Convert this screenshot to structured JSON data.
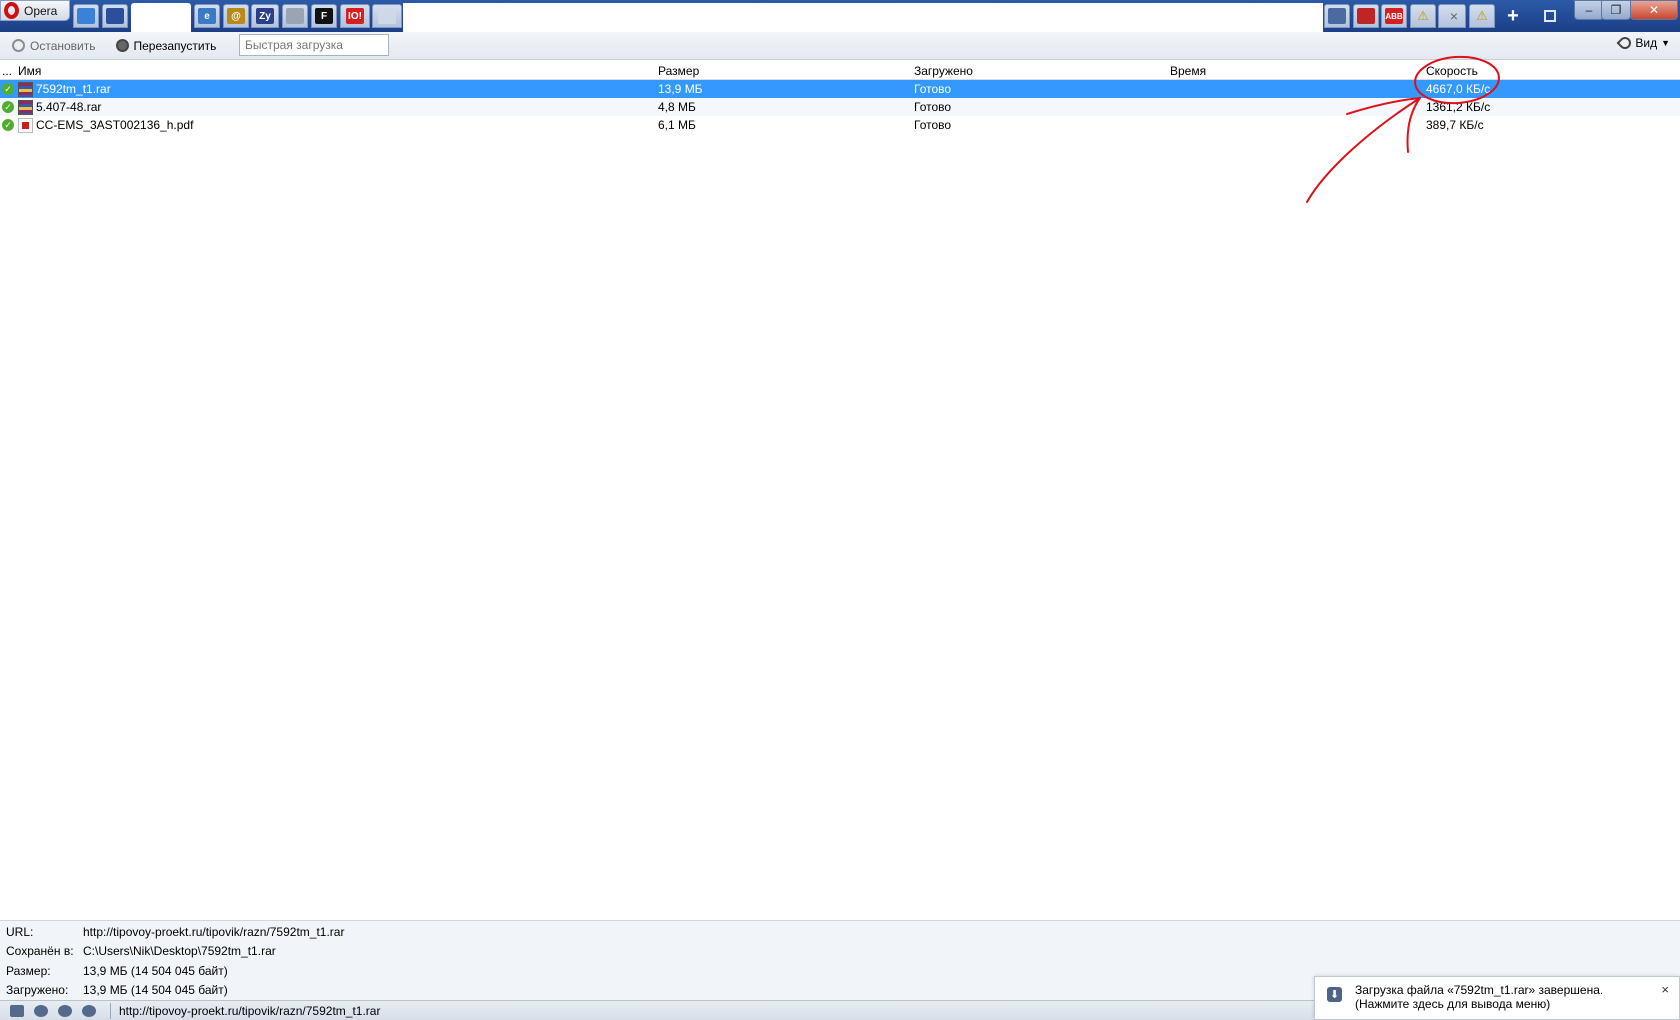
{
  "app": {
    "menu_label": "Opera"
  },
  "tabs": [
    {
      "icon": "water-drop-icon",
      "color": "#3b82d6",
      "glyph": ""
    },
    {
      "icon": "globe-grid-icon",
      "color": "#2b4f9a",
      "glyph": ""
    },
    {
      "icon": "blank-page-icon",
      "color": "#ffffff",
      "glyph": "",
      "active": true
    },
    {
      "icon": "ie-window-icon",
      "color": "#3a79c6",
      "glyph": "e"
    },
    {
      "icon": "at-mail-icon",
      "color": "#b88a1a",
      "glyph": "@"
    },
    {
      "icon": "zy-site-icon",
      "color": "#2b3f8a",
      "glyph": "Zy"
    },
    {
      "icon": "document-icon",
      "color": "#9aa4b3",
      "glyph": ""
    },
    {
      "icon": "f-site-icon",
      "color": "#111111",
      "glyph": "F"
    },
    {
      "icon": "io-site-icon",
      "color": "#d42020",
      "glyph": "IO!"
    },
    {
      "icon": "blank-tab-icon",
      "color": "#cfd8e6",
      "glyph": ""
    }
  ],
  "right_tabs": [
    {
      "icon": "downloads-icon",
      "color": "#4a6aa0",
      "glyph": ""
    },
    {
      "icon": "plane-icon",
      "color": "#c02525",
      "glyph": ""
    },
    {
      "icon": "abb-icon",
      "color": "#d42020",
      "glyph": "ABB"
    },
    {
      "icon": "warning-icon",
      "color": "#e3b400",
      "glyph": "⚠"
    },
    {
      "icon": "warning-icon",
      "color": "#e3b400",
      "glyph": "⚠"
    }
  ],
  "toolbar": {
    "stop_label": "Остановить",
    "restart_label": "Перезапустить",
    "quick_placeholder": "Быстрая загрузка",
    "view_label": "Вид"
  },
  "columns": {
    "dots": "...",
    "name": "Имя",
    "size": "Размер",
    "done": "Загружено",
    "time": "Время",
    "speed": "Скорость"
  },
  "downloads": [
    {
      "name": "7592tm_t1.rar",
      "size": "13,9 МБ",
      "status": "Готово",
      "time": "",
      "speed": "4667,0 КБ/с",
      "type": "rar"
    },
    {
      "name": "5.407-48.rar",
      "size": "4,8 МБ",
      "status": "Готово",
      "time": "",
      "speed": "1361,2 КБ/с",
      "type": "rar"
    },
    {
      "name": "CC-EMS_3AST002136_h.pdf",
      "size": "6,1 МБ",
      "status": "Готово",
      "time": "",
      "speed": "389,7 КБ/с",
      "type": "pdf"
    }
  ],
  "details": {
    "url_label": "URL:",
    "url_value": "http://tipovoy-proekt.ru/tipovik/razn/7592tm_t1.rar",
    "saved_label": "Сохранён в:",
    "saved_value": "C:\\Users\\Nik\\Desktop\\7592tm_t1.rar",
    "size_label": "Размер:",
    "size_value": "13,9 МБ (14 504 045 байт)",
    "loaded_label": "Загружено:",
    "loaded_value": "13,9 МБ (14 504 045 байт)"
  },
  "statusbar": {
    "url": "http://tipovoy-proekt.ru/tipovik/razn/7592tm_t1.rar"
  },
  "notification": {
    "line1": "Загрузка файла «7592tm_t1.rar» завершена.",
    "line2": "(Нажмите здесь для вывода меню)",
    "close": "×"
  },
  "colors": {
    "selection": "#3399ff",
    "annotation": "#e0101a",
    "tabbar": "#1c3f86"
  }
}
